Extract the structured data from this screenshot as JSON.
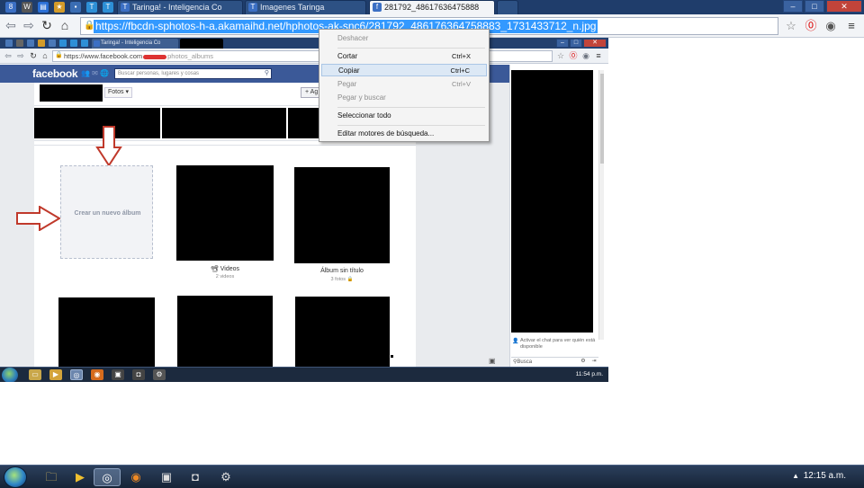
{
  "outer_window": {
    "tabs": [
      {
        "label": "Taringa! - Inteligencia Co",
        "active": false
      },
      {
        "label": "Imagenes Taringa",
        "active": false
      },
      {
        "label": "281792_48617636475888",
        "active": true
      }
    ],
    "url": "https://fbcdn-sphotos-h-a.akamaihd.net/hphotos-ak-snc6/281792_486176364758883_1731433712_n.jpg",
    "window_controls": {
      "minimize": "–",
      "maximize": "□",
      "close": "✕"
    }
  },
  "inner_window": {
    "tabs": [
      "Taringa! - Inteligencia Co",
      ""
    ],
    "url_prefix": "https://www.facebook.com",
    "url_path": "photos_albums",
    "window_controls": {
      "minimize": "–",
      "maximize": "□",
      "close": "✕"
    }
  },
  "facebook": {
    "logo": "facebook",
    "search_placeholder": "Buscar personas, lugares y cosas",
    "photos_tab": "Fotos ▾",
    "add_button": "+ Ag",
    "create_album": "Crear un nuevo álbum",
    "albums": [
      {
        "title": "📽 Videos",
        "subtitle": "2 videos"
      },
      {
        "title": "Álbum sin título",
        "subtitle": "3 fotos 🔒"
      }
    ]
  },
  "chat": {
    "notice": "Activar el chat para ver quién está disponible",
    "search_label": "Busca"
  },
  "context_menu": {
    "items": [
      {
        "label": "Deshacer",
        "shortcut": "",
        "disabled": true
      },
      {
        "label": "Cortar",
        "shortcut": "Ctrl+X",
        "disabled": false
      },
      {
        "label": "Copiar",
        "shortcut": "Ctrl+C",
        "disabled": false,
        "hover": true
      },
      {
        "label": "Pegar",
        "shortcut": "Ctrl+V",
        "disabled": true
      },
      {
        "label": "Pegar y buscar",
        "shortcut": "",
        "disabled": true
      },
      {
        "label": "Seleccionar todo",
        "shortcut": "",
        "disabled": false
      },
      {
        "label": "Editar motores de búsqueda...",
        "shortcut": "",
        "disabled": false
      }
    ]
  },
  "inner_taskbar": {
    "clock": "11:54 p.m."
  },
  "taskbar": {
    "clock": "12:15 a.m."
  },
  "colors": {
    "facebook_blue": "#3b5998",
    "selection": "#3399ff",
    "annotation_red": "#c0392b"
  }
}
